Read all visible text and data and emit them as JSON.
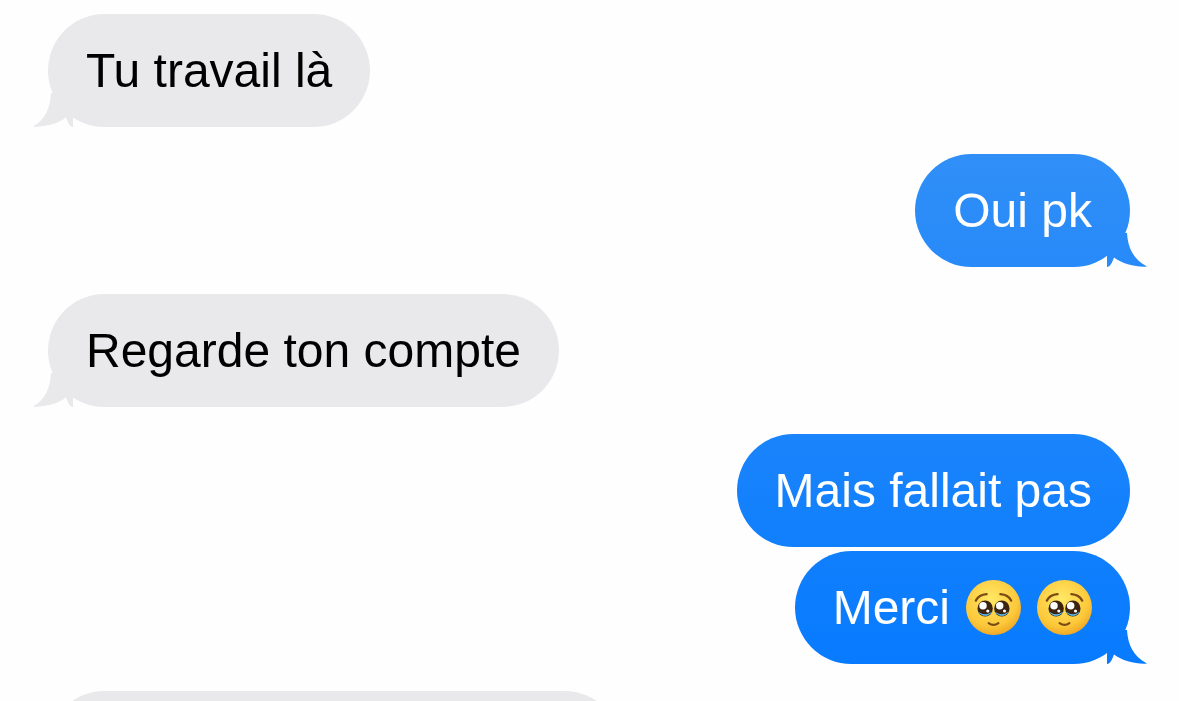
{
  "messages": [
    {
      "kind": "received",
      "text": "Tu travail là",
      "tail": true
    },
    {
      "kind": "sent",
      "text": "Oui pk",
      "tail": true
    },
    {
      "kind": "received",
      "text": "Regarde ton compte",
      "tail": true
    },
    {
      "kind": "sent",
      "text": "Mais fallait pas",
      "tail": false
    },
    {
      "kind": "sent",
      "text": "Merci",
      "icons": [
        {
          "kind": "pleading-face"
        },
        {
          "kind": "pleading-face"
        }
      ],
      "tail": true
    },
    {
      "kind": "received"
    }
  ]
}
